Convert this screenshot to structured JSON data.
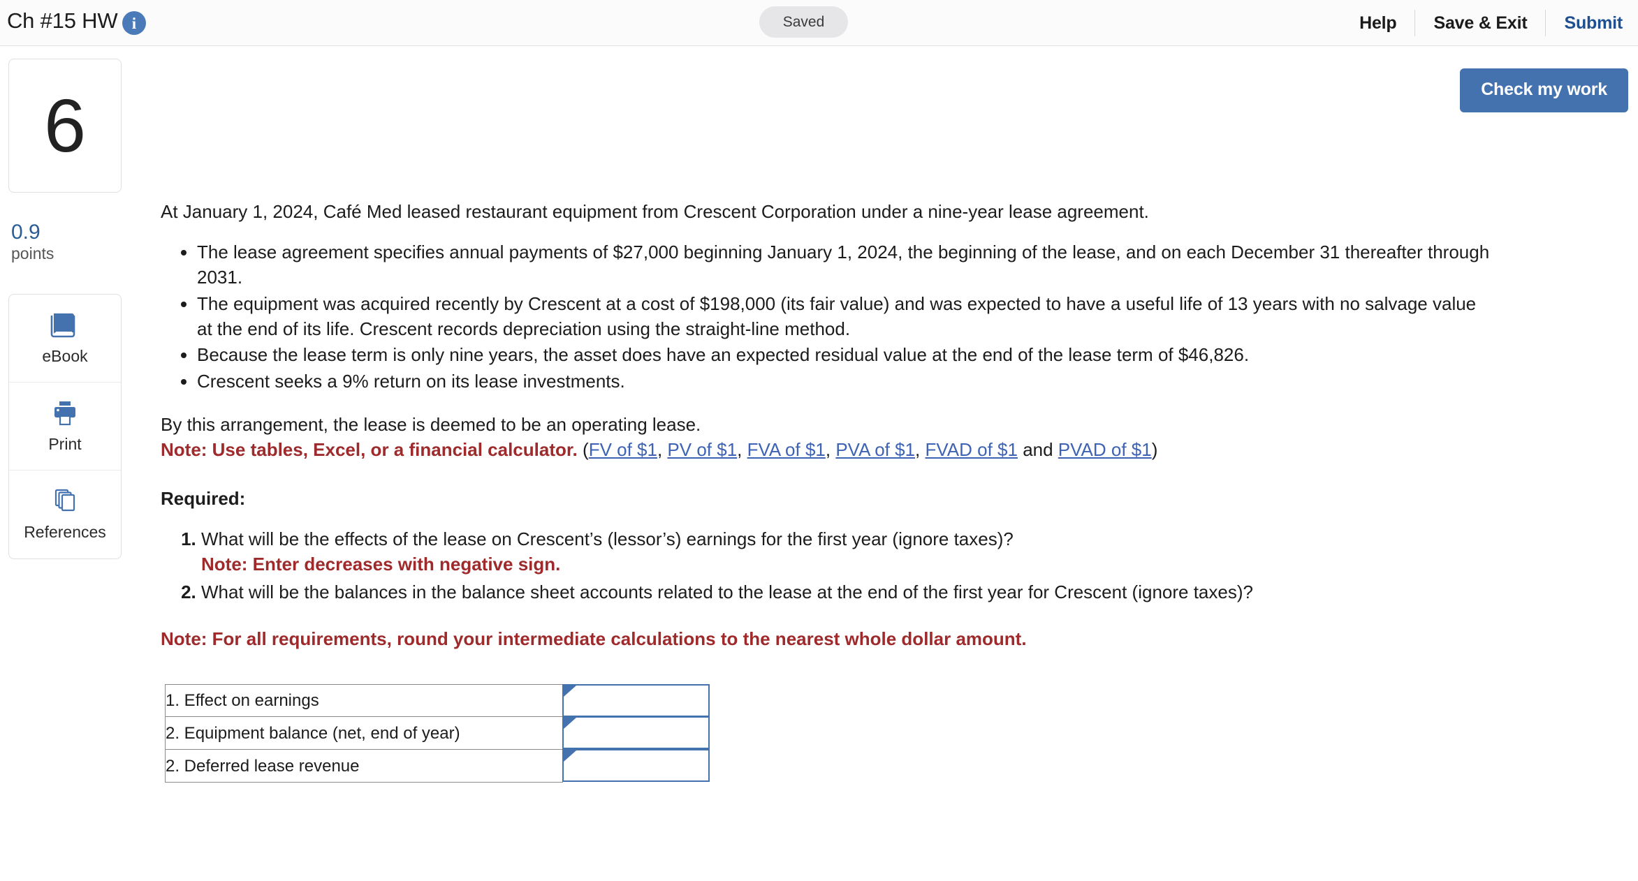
{
  "topbar": {
    "assignment_title": "Ch #15 HW",
    "info_icon": "info-icon",
    "save_status": "Saved",
    "help_label": "Help",
    "save_exit_label": "Save & Exit",
    "submit_label": "Submit",
    "accent_color": "#1d4f91"
  },
  "rail": {
    "question_number": "6",
    "points_value": "0.9",
    "points_label": "points",
    "tools": [
      {
        "label": "eBook",
        "icon": "book-icon"
      },
      {
        "label": "Print",
        "icon": "printer-icon"
      },
      {
        "label": "References",
        "icon": "documents-icon"
      }
    ]
  },
  "actions": {
    "check_my_work_label": "Check my work",
    "check_my_work_color": "#4472ae"
  },
  "question": {
    "intro": "At January 1, 2024, Café Med leased restaurant equipment from Crescent Corporation under a nine-year lease agreement.",
    "facts": [
      "The lease agreement specifies annual payments of $27,000 beginning January 1, 2024, the beginning of the lease, and on each December 31 thereafter through 2031.",
      "The equipment was acquired recently by Crescent at a cost of $198,000 (its fair value) and was expected to have a useful life of 13 years with no salvage value at the end of its life. Crescent records depreciation using the straight-line method.",
      "Because the lease term is only nine years, the asset does have an expected residual value at the end of the lease term of $46,826.",
      "Crescent seeks a 9% return on its lease investments."
    ],
    "arrangement": "By this arrangement, the lease is deemed to be an operating lease.",
    "tables_note": "Note: Use tables, Excel, or a financial calculator.",
    "links_open": "(",
    "links": [
      {
        "label": "FV of $1",
        "after": ", "
      },
      {
        "label": "PV of $1",
        "after": ", "
      },
      {
        "label": "FVA of $1",
        "after": ", "
      },
      {
        "label": "PVA of $1",
        "after": ", "
      },
      {
        "label": "FVAD of $1",
        "after": " and "
      },
      {
        "label": "PVAD of $1",
        "after": ""
      }
    ],
    "links_close": ")",
    "required_heading": "Required:",
    "requirements": [
      {
        "text": "What will be the effects of the lease on Crescent’s (lessor’s) earnings for the first year (ignore taxes)?",
        "note": "Note: Enter decreases with negative sign."
      },
      {
        "text": "What will be the balances in the balance sheet accounts related to the lease at the end of the first year for Crescent (ignore taxes)?",
        "note": ""
      }
    ],
    "round_note": "Note: For all requirements, round your intermediate calculations to the nearest whole dollar amount.",
    "note_color": "#9e2a2b"
  },
  "answer_table": {
    "rows": [
      {
        "label": "1. Effect on earnings",
        "value": ""
      },
      {
        "label": "2. Equipment balance (net, end of year)",
        "value": ""
      },
      {
        "label": "2. Deferred lease revenue",
        "value": ""
      }
    ]
  }
}
